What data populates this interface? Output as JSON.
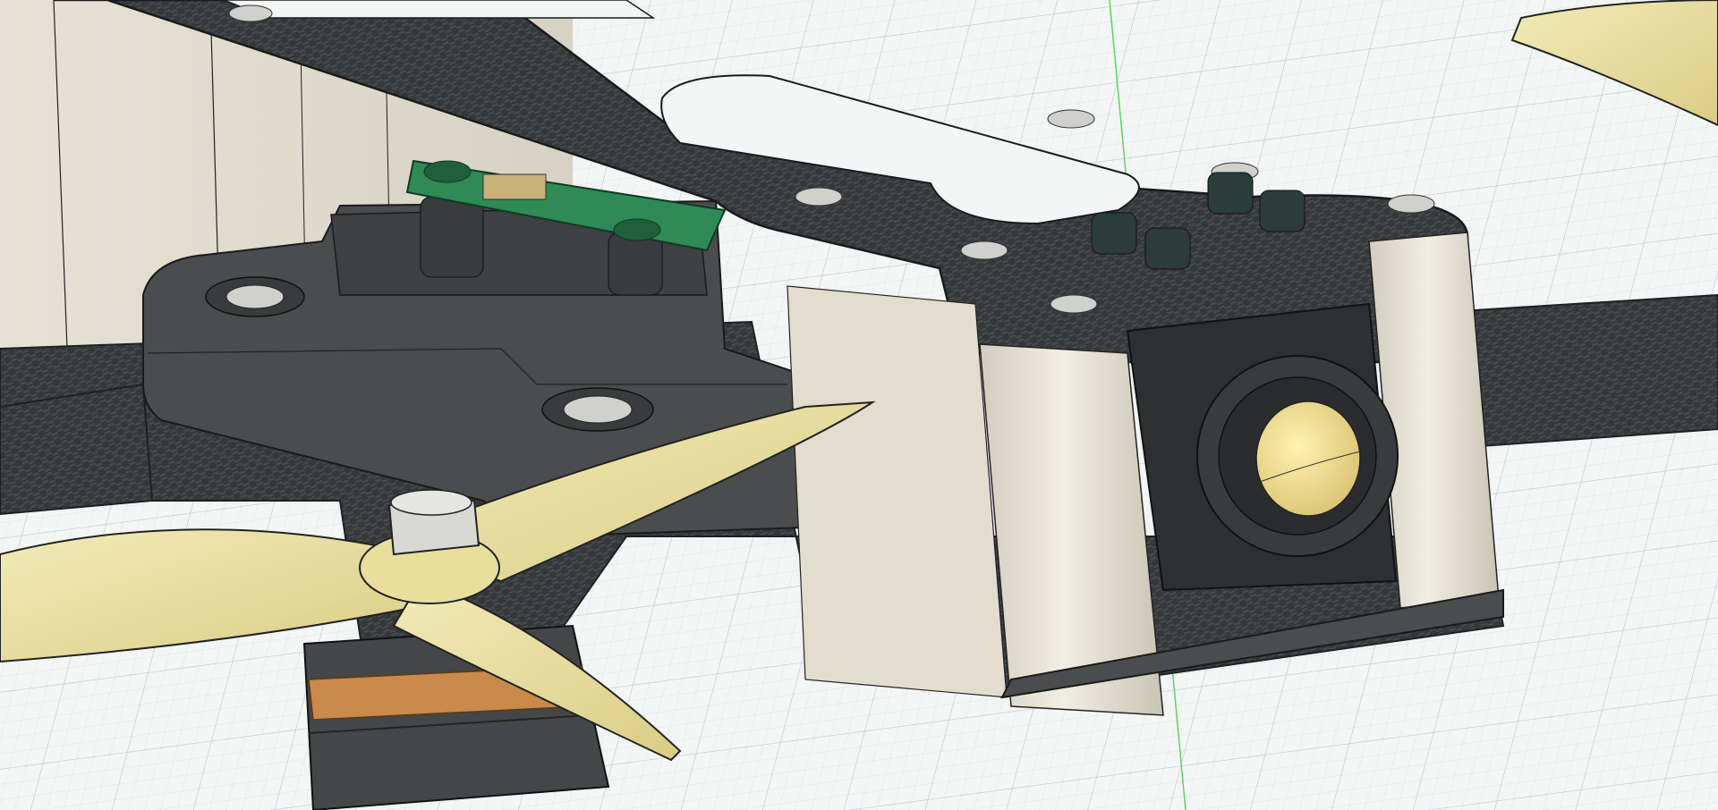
{
  "viewport": {
    "background_color": "#f4f6f6",
    "grid_minor_color": "#dde3e5",
    "grid_major_color": "#c7d0d4",
    "axis_color": "#5fd35f"
  },
  "model": {
    "carbon_dark": "#35383a",
    "carbon_light": "#5a5e60",
    "standoff_color": "#e8e4d8",
    "mount_color": "#4a4c4d",
    "pcb_color": "#2f8a56",
    "propeller_color": "#e9e0a0",
    "motor_bell_color": "#454647",
    "copper_color": "#c98a4a",
    "lens_color": "#f0dc88",
    "screw_color": "#d0d0cc"
  }
}
